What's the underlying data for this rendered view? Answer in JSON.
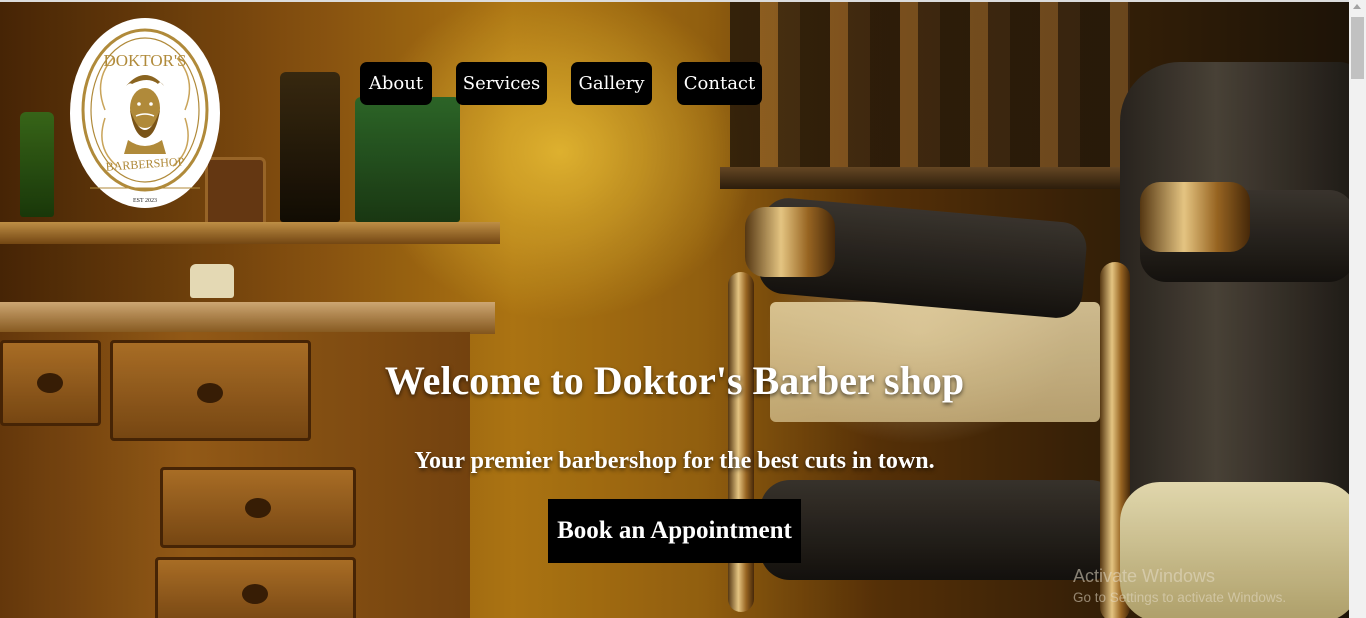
{
  "logo": {
    "top_text": "DOKTOR'S",
    "bottom_text": "BARBERSHOP",
    "est_text": "EST 2023"
  },
  "nav": {
    "items": [
      {
        "label": "About"
      },
      {
        "label": "Services"
      },
      {
        "label": "Gallery"
      },
      {
        "label": "Contact"
      }
    ]
  },
  "hero": {
    "title": "Welcome to Doktor's Barber shop",
    "subtitle": "Your premier barbershop for the best cuts in town.",
    "cta_label": "Book an Appointment"
  },
  "watermark": {
    "line1": "Activate Windows",
    "line2": "Go to Settings to activate Windows."
  },
  "colors": {
    "nav_bg": "#000000",
    "logo_gold": "#b08a3a",
    "text": "#ffffff"
  }
}
